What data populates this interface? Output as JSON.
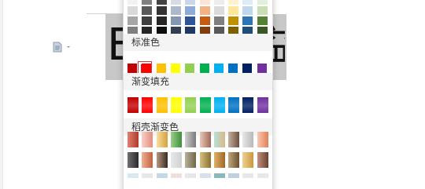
{
  "document": {
    "text_left": "E",
    "text_right": "益"
  },
  "palette": {
    "theme_rows": [
      [
        "#f2f2f2",
        "#808080",
        "#444444",
        "#d6dce4",
        "#cad6ea",
        "#fbe5d6",
        "#ededed",
        "#fff2cc",
        "#ddebf7",
        "#e2efda"
      ],
      [
        "#d9d9d9",
        "#595959",
        "#333333",
        "#acb9ca",
        "#8ea9db",
        "#f4b183",
        "#dbdbdb",
        "#ffe699",
        "#bdd7ee",
        "#c6e0b4"
      ],
      [
        "#a6a6a6",
        "#3f3f3f",
        "#262626",
        "#8497b0",
        "#2f5597",
        "#c55a11",
        "#7f7f7f",
        "#bf9000",
        "#2e75b6",
        "#548235"
      ],
      [
        "#7f7f7f",
        "#262626",
        "#0d0d0d",
        "#333f50",
        "#1f3864",
        "#833c0b",
        "#595959",
        "#7f6000",
        "#1f4e79",
        "#385723"
      ]
    ],
    "standard_label": "标准色",
    "standard_colors": [
      "#c00000",
      "#ff0000",
      "#ffc000",
      "#ffff00",
      "#92d050",
      "#00b050",
      "#00b0f0",
      "#0070c0",
      "#002060",
      "#7030a0"
    ],
    "gradient_fill_label": "渐变填充",
    "gradient_colors": [
      "#c00000",
      "#ff0000",
      "#ffc000",
      "#ffff00",
      "#92d050",
      "#00b050",
      "#00b0f0",
      "#0070c0",
      "#002060",
      "#7030a0"
    ],
    "shell_gradient_label": "稻壳渐变色",
    "shell_rows": [
      [
        [
          "#e08070",
          "#b03a2e"
        ],
        [
          "#f8d0c8",
          "#e58c7e"
        ],
        [
          "#f6e0a0",
          "#d6a040"
        ],
        [
          "#9ad08a",
          "#3f8e3a"
        ],
        [
          "#d0d0d0",
          "#7a7a7a"
        ],
        [
          "#e8c8b8",
          "#a06858"
        ],
        [
          "#b8e0d8",
          "#d8b888"
        ],
        [
          "#c8b0a0",
          "#6a5040"
        ],
        [
          "#e8e8e8",
          "#b8b8b8"
        ],
        [
          "#f8c8b0",
          "#e0805a"
        ]
      ],
      [
        [
          "#707070",
          "#2a2a2a"
        ],
        [
          "#f0b090",
          "#c06040"
        ],
        [
          "#b89880",
          "#3a2a20"
        ],
        [
          "#e8e8e8",
          "#d0d0d0"
        ],
        [
          "#b8b098",
          "#706848"
        ],
        [
          "#d8c080",
          "#8a7030"
        ],
        [
          "#e0b068",
          "#a0682a"
        ],
        [
          "#c0a878",
          "#6a5030"
        ],
        [
          "#f0d090",
          "#c89840"
        ],
        [
          "#c09080",
          "#6a4030"
        ]
      ],
      [
        [
          "#d8e8f0",
          "#d8e8f0"
        ],
        [
          "#e8e8e8",
          "#e8e8e8"
        ],
        [
          "#c0d8e8",
          "#c0d8e8"
        ],
        [
          "#f0e0e0",
          "#f0e0e0"
        ],
        [
          "#e8e8e8",
          "#e8e8e8"
        ],
        [
          "#d8e0e8",
          "#d8e0e8"
        ],
        [
          "#88b8b8",
          "#88b8b8"
        ],
        [
          "#c0d0e0",
          "#c0d0e0"
        ],
        [
          "#e8e8e8",
          "#e8e8e8"
        ],
        [
          "#e8e8e8",
          "#e8e8e8"
        ]
      ]
    ]
  }
}
